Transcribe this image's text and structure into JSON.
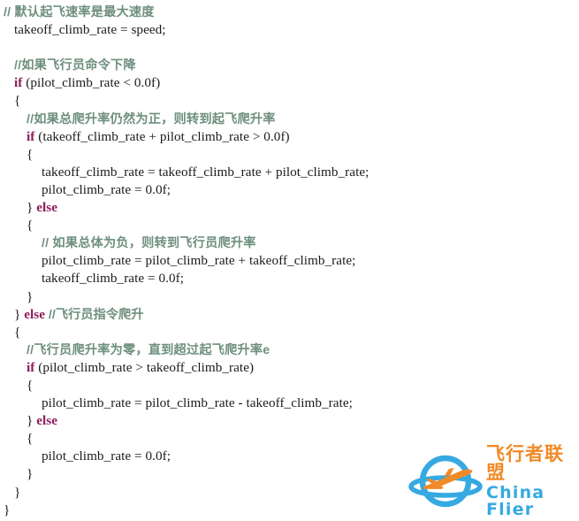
{
  "document": {
    "type": "code-listing",
    "language": "C++",
    "background_color": "#ffffff",
    "colors": {
      "comment": "#6e8f7e",
      "keyword": "#8b1c5c",
      "code": "#1b1b1b",
      "logo_blue": "#36a9e1",
      "logo_orange": "#f08a28"
    }
  },
  "code": {
    "lines": [
      {
        "indent": 0,
        "segments": [
          {
            "type": "comment",
            "text": "// 默认起飞速率是最大速度"
          }
        ]
      },
      {
        "indent": 1,
        "segments": [
          {
            "type": "code",
            "text": "takeoff_climb_rate = speed;"
          }
        ]
      },
      {
        "indent": 0,
        "segments": [
          {
            "type": "code",
            "text": ""
          }
        ]
      },
      {
        "indent": 1,
        "segments": [
          {
            "type": "comment",
            "text": "//如果飞行员命令下降"
          }
        ]
      },
      {
        "indent": 1,
        "segments": [
          {
            "type": "keyword",
            "text": "if"
          },
          {
            "type": "code",
            "text": " (pilot_climb_rate < 0.0f)"
          }
        ]
      },
      {
        "indent": 1,
        "segments": [
          {
            "type": "code",
            "text": "{"
          }
        ]
      },
      {
        "indent": 2,
        "segments": [
          {
            "type": "comment",
            "text": "//如果总爬升率仍然为正，则转到起飞爬升率"
          }
        ]
      },
      {
        "indent": 2,
        "segments": [
          {
            "type": "keyword",
            "text": "if"
          },
          {
            "type": "code",
            "text": " (takeoff_climb_rate + pilot_climb_rate > 0.0f)"
          }
        ]
      },
      {
        "indent": 2,
        "segments": [
          {
            "type": "code",
            "text": "{"
          }
        ]
      },
      {
        "indent": 3,
        "segments": [
          {
            "type": "code",
            "text": "takeoff_climb_rate = takeoff_climb_rate + pilot_climb_rate;"
          }
        ]
      },
      {
        "indent": 3,
        "segments": [
          {
            "type": "code",
            "text": "pilot_climb_rate = 0.0f;"
          }
        ]
      },
      {
        "indent": 2,
        "segments": [
          {
            "type": "code",
            "text": "} "
          },
          {
            "type": "keyword",
            "text": "else"
          }
        ]
      },
      {
        "indent": 2,
        "segments": [
          {
            "type": "code",
            "text": "{"
          }
        ]
      },
      {
        "indent": 3,
        "segments": [
          {
            "type": "comment",
            "text": "// 如果总体为负，则转到飞行员爬升率"
          }
        ]
      },
      {
        "indent": 3,
        "segments": [
          {
            "type": "code",
            "text": "pilot_climb_rate = pilot_climb_rate + takeoff_climb_rate;"
          }
        ]
      },
      {
        "indent": 3,
        "segments": [
          {
            "type": "code",
            "text": "takeoff_climb_rate = 0.0f;"
          }
        ]
      },
      {
        "indent": 2,
        "segments": [
          {
            "type": "code",
            "text": "}"
          }
        ]
      },
      {
        "indent": 1,
        "segments": [
          {
            "type": "code",
            "text": "} "
          },
          {
            "type": "keyword",
            "text": "else"
          },
          {
            "type": "code",
            "text": " "
          },
          {
            "type": "comment",
            "text": "//飞行员指令爬升"
          }
        ]
      },
      {
        "indent": 1,
        "segments": [
          {
            "type": "code",
            "text": "{"
          }
        ]
      },
      {
        "indent": 2,
        "segments": [
          {
            "type": "comment",
            "text": "//飞行员爬升率为零，直到超过起飞爬升率e"
          }
        ]
      },
      {
        "indent": 2,
        "segments": [
          {
            "type": "keyword",
            "text": "if"
          },
          {
            "type": "code",
            "text": " (pilot_climb_rate > takeoff_climb_rate)"
          }
        ]
      },
      {
        "indent": 2,
        "segments": [
          {
            "type": "code",
            "text": "{"
          }
        ]
      },
      {
        "indent": 3,
        "segments": [
          {
            "type": "code",
            "text": "pilot_climb_rate = pilot_climb_rate - takeoff_climb_rate;"
          }
        ]
      },
      {
        "indent": 2,
        "segments": [
          {
            "type": "code",
            "text": "} "
          },
          {
            "type": "keyword",
            "text": "else"
          }
        ]
      },
      {
        "indent": 2,
        "segments": [
          {
            "type": "code",
            "text": "{"
          }
        ]
      },
      {
        "indent": 3,
        "segments": [
          {
            "type": "code",
            "text": "pilot_climb_rate = 0.0f;"
          }
        ]
      },
      {
        "indent": 2,
        "segments": [
          {
            "type": "code",
            "text": "}"
          }
        ]
      },
      {
        "indent": 1,
        "segments": [
          {
            "type": "code",
            "text": "}"
          }
        ]
      },
      {
        "indent": 0,
        "segments": [
          {
            "type": "code",
            "text": "}"
          }
        ]
      }
    ]
  },
  "watermark": {
    "name_cn": "飞行者联盟",
    "name_en": "China Flier",
    "mark": "airplane-orbit-logo"
  }
}
